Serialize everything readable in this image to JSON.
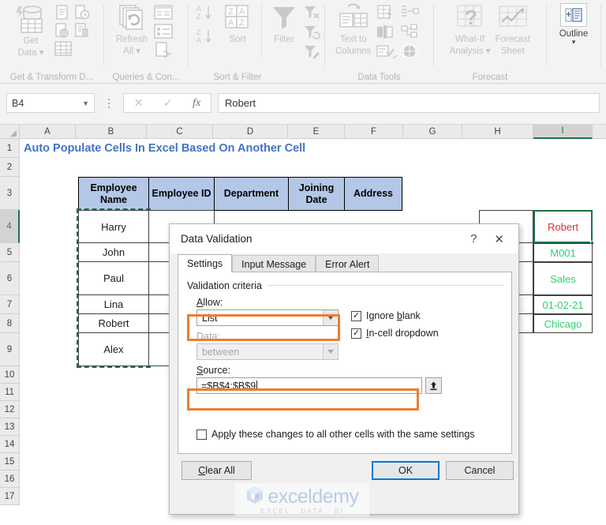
{
  "ribbon": {
    "groups": [
      {
        "label": "Get & Transform D...",
        "buttons": [
          {
            "label": "Get Data",
            "icon": "get-data-icon"
          }
        ]
      },
      {
        "label": "Queries & Con...",
        "buttons": [
          {
            "label": "Refresh All",
            "icon": "refresh-all-icon"
          }
        ]
      },
      {
        "label": "Sort & Filter",
        "buttons": [
          {
            "label": "Sort",
            "icon": "sort-icon"
          },
          {
            "label": "Filter",
            "icon": "filter-icon"
          }
        ]
      },
      {
        "label": "Data Tools",
        "buttons": [
          {
            "label": "Text to Columns",
            "icon": "text-to-columns-icon"
          }
        ]
      },
      {
        "label": "Forecast",
        "buttons": [
          {
            "label": "What-If Analysis",
            "icon": "what-if-icon"
          },
          {
            "label": "Forecast Sheet",
            "icon": "forecast-sheet-icon"
          }
        ]
      },
      {
        "label": "",
        "buttons": [
          {
            "label": "Outline",
            "icon": "outline-icon"
          }
        ]
      }
    ],
    "get_data_l1": "Get",
    "get_data_l2": "Data",
    "refresh_l1": "Refresh",
    "refresh_l2": "All",
    "sort_label": "Sort",
    "filter_label": "Filter",
    "ttc_l1": "Text to",
    "ttc_l2": "Columns",
    "whatif_l1": "What-If",
    "whatif_l2": "Analysis",
    "forecast_l1": "Forecast",
    "forecast_l2": "Sheet",
    "outline_label": "Outline",
    "az_label": "A\nZ",
    "za_label": "Z\nA"
  },
  "formula_bar": {
    "name_box_value": "B4",
    "cancel_icon": "cancel-x-icon",
    "enter_icon": "enter-check-icon",
    "function_icon": "insert-function-icon",
    "formula_value": "Robert"
  },
  "grid": {
    "columns": [
      "A",
      "B",
      "C",
      "D",
      "E",
      "F",
      "G",
      "H",
      "I"
    ],
    "selected_column": "I",
    "rows": [
      "1",
      "2",
      "3",
      "4",
      "5",
      "6",
      "7",
      "8",
      "9",
      "10",
      "11",
      "12",
      "13",
      "14",
      "15",
      "16",
      "17"
    ],
    "selected_row": "4",
    "title": "Auto Populate Cells In Excel Based On Another Cell",
    "table_headers": [
      "Employee Name",
      "Employee ID",
      "Department",
      "Joining Date",
      "Address"
    ],
    "employee_names": [
      "Harry",
      "John",
      "Paul",
      "Lina",
      "Robert",
      "Alex"
    ],
    "result_cells": [
      {
        "value": "Robert",
        "color": "#e03030",
        "selected": true
      },
      {
        "value": "M001",
        "color": "#2fd170",
        "selected": false
      },
      {
        "value": "Sales",
        "color": "#2fd170",
        "selected": false
      },
      {
        "value": "01-02-21",
        "color": "#2fd170",
        "selected": false
      },
      {
        "value": "Chicago",
        "color": "#2fd170",
        "selected": false
      }
    ]
  },
  "dialog": {
    "title": "Data Validation",
    "help_icon": "help-question-icon",
    "close_icon": "close-x-icon",
    "tabs": [
      {
        "label": "Settings",
        "active": true
      },
      {
        "label": "Input Message",
        "active": false
      },
      {
        "label": "Error Alert",
        "active": false
      }
    ],
    "section_title": "Validation criteria",
    "allow_label": "Allow:",
    "allow_value": "List",
    "data_label": "Data:",
    "data_value": "between",
    "source_label": "Source:",
    "source_value": "=$B$4:$B$9",
    "range_select_icon": "collapse-dialog-icon",
    "ignore_blank": {
      "label": "Ignore blank",
      "checked": true
    },
    "in_cell_dropdown": {
      "label": "In-cell dropdown",
      "checked": true
    },
    "apply_all": {
      "label": "Apply these changes to all other cells with the same settings",
      "checked": false
    },
    "buttons": {
      "clear_all": "Clear All",
      "ok": "OK",
      "cancel": "Cancel"
    }
  },
  "watermark": {
    "name": "exceldemy",
    "tagline": "EXCEL · DATA · BI",
    "logo_icon": "exceldemy-cube-logo"
  },
  "colors": {
    "title_blue": "#4472c4",
    "header_fill": "#b4c7e7",
    "annotation_orange": "#ed7d31",
    "selection_green": "#1e7145",
    "primary_blue": "#0078d7"
  }
}
